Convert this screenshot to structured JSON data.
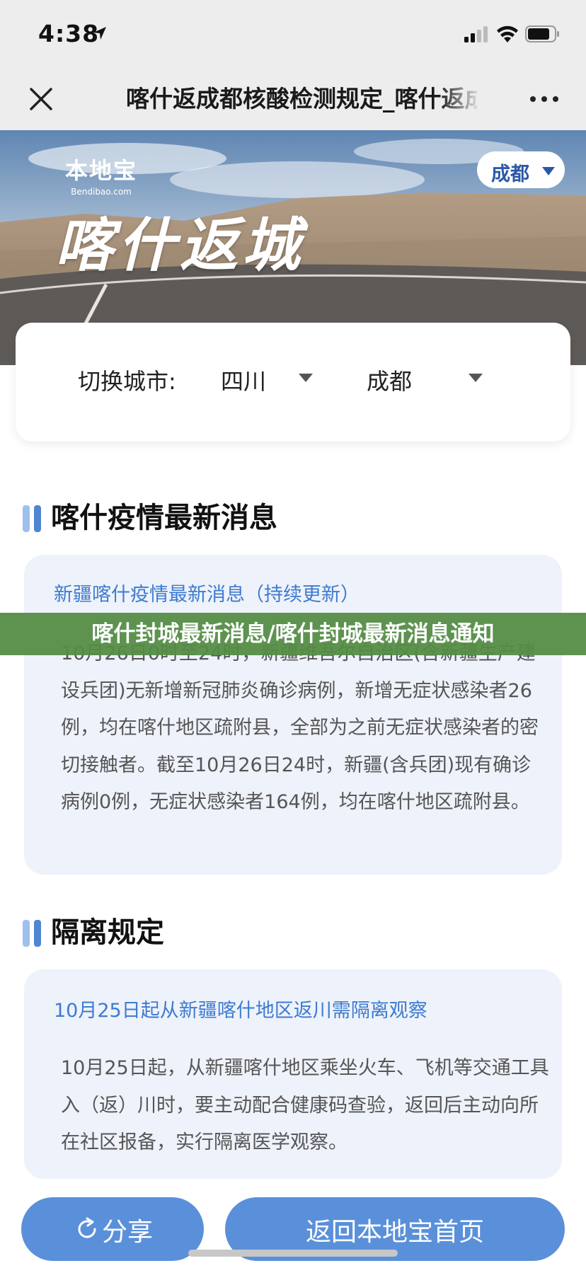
{
  "status_bar": {
    "time": "4:38"
  },
  "nav": {
    "title": "喀什返成都核酸检测规定_喀什返成都"
  },
  "hero": {
    "logo": "本地宝",
    "logo_sub": "Bendibao.com",
    "title": "喀什返城",
    "city_button": "成都"
  },
  "switcher": {
    "label": "切换城市:",
    "province": "四川",
    "city": "成都"
  },
  "sections": [
    {
      "title": "喀什疫情最新消息",
      "card_title": "新疆喀什疫情最新消息（持续更新）",
      "card_body": "10月26日0时至24时，新疆维吾尔自治区(含新疆生产建设兵团)无新增新冠肺炎确诊病例，新增无症状感染者26例，均在喀什地区疏附县，全部为之前无症状感染者的密切接触者。截至10月26日24时，新疆(含兵团)现有确诊病例0例，无症状感染者164例，均在喀什地区疏附县。"
    },
    {
      "title": "隔离规定",
      "card_title": "10月25日起从新疆喀什地区返川需隔离观察",
      "card_body": "10月25日起，从新疆喀什地区乘坐火车、飞机等交通工具入（返）川时，要主动配合健康码查验，返回后主动向所在社区报备，实行隔离医学观察。"
    }
  ],
  "banner": {
    "text": "喀什封城最新消息/喀什封城最新消息通知"
  },
  "footer": {
    "share": "分享",
    "home": "返回本地宝首页"
  },
  "colors": {
    "accent": "#5a90da",
    "link": "#3d7bd0",
    "banner": "#548c44",
    "card_bg": "#eef2fa"
  }
}
